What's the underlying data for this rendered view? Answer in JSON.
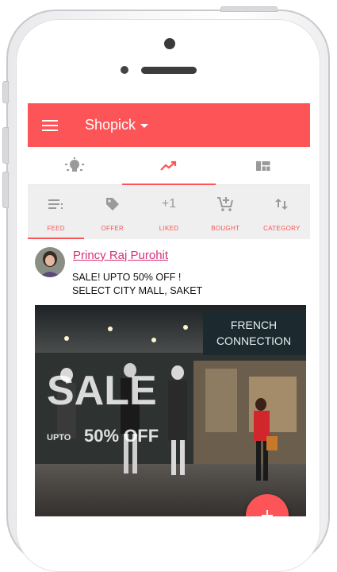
{
  "app": {
    "title": "Shopick"
  },
  "top_tabs": [
    {
      "name": "bulb-icon",
      "active": false
    },
    {
      "name": "trending-icon",
      "active": true
    },
    {
      "name": "dashboard-icon",
      "active": false
    }
  ],
  "sub_tabs": [
    {
      "label": "FEED",
      "icon": "list-icon",
      "active": true
    },
    {
      "label": "OFFER",
      "icon": "tag-icon",
      "active": false
    },
    {
      "label": "LIKED",
      "icon": "+1",
      "active": false
    },
    {
      "label": "BOUGHT",
      "icon": "cart-add-icon",
      "active": false
    },
    {
      "label": "CATEGORY",
      "icon": "sort-icon",
      "active": false
    }
  ],
  "post": {
    "author": "Princy Raj Purohit",
    "line1": "SALE! UPTO 50% OFF !",
    "line2": "SELECT CITY MALL, SAKET",
    "image": {
      "store_sign_line1": "FRENCH",
      "store_sign_line2": "CONNECTION",
      "window_sale": "SALE",
      "window_upto": "UPTO",
      "window_percent": "50% OFF"
    }
  },
  "fab": {
    "label": "+"
  },
  "colors": {
    "accent": "#fd5457",
    "author": "#d4317a",
    "tab_bg": "#efefef"
  }
}
